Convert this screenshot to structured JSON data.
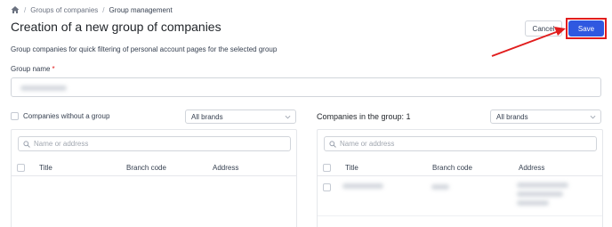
{
  "breadcrumb": {
    "home_icon": "home-icon",
    "items": [
      "Groups of companies",
      "Group management"
    ],
    "separator": "/"
  },
  "page": {
    "title": "Creation of a new group of companies",
    "subtitle": "Group companies for quick filtering of personal account pages for the selected group"
  },
  "actions": {
    "cancel_label": "Cancel",
    "save_label": "Save"
  },
  "colors": {
    "accent": "#2f58e0",
    "annotation": "#e11d1d"
  },
  "group_name": {
    "label": "Group name",
    "required_mark": "*"
  },
  "left_panel": {
    "checkbox_label": "Companies without a group",
    "brand_select": "All brands",
    "search_placeholder": "Name or address",
    "columns": [
      "Title",
      "Branch code",
      "Address"
    ]
  },
  "right_panel": {
    "title": "Companies in the group: 1",
    "brand_select": "All brands",
    "search_placeholder": "Name or address",
    "columns": [
      "Title",
      "Branch code",
      "Address"
    ]
  }
}
